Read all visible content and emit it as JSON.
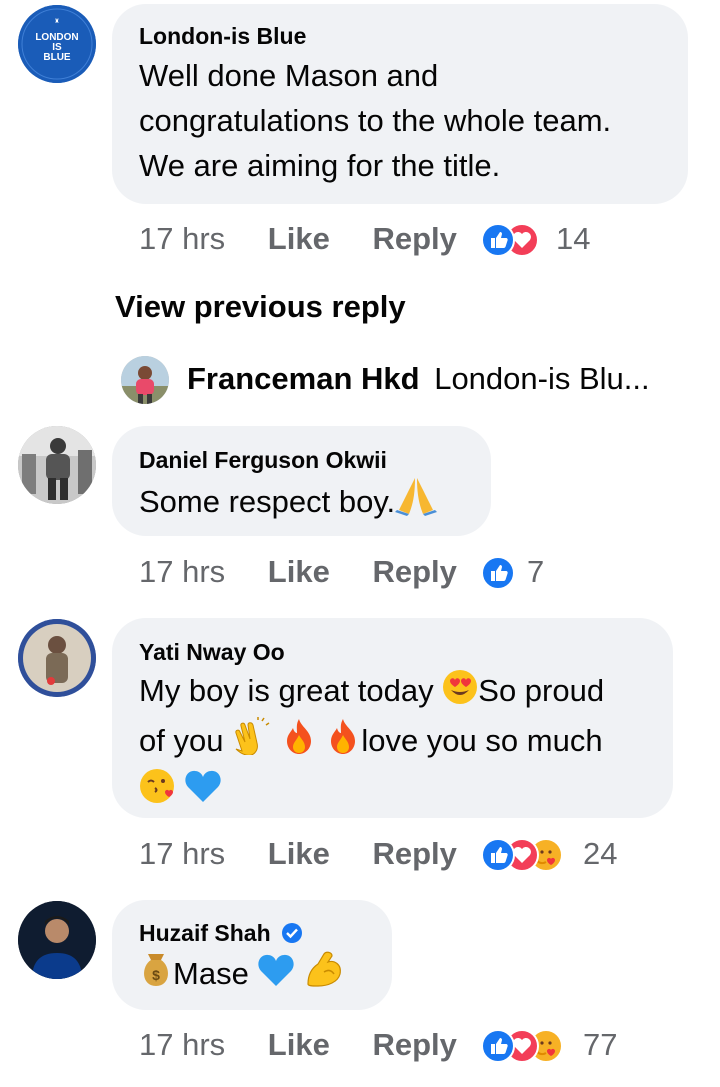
{
  "comments": [
    {
      "author": "London-is Blue",
      "avatar_text": [
        "LONDON",
        "IS",
        "BLUE"
      ],
      "lines": [
        "Well done Mason and",
        "congratulations to the whole team.",
        "We are aiming for the title."
      ],
      "time": "17 hrs",
      "like": "Like",
      "reply": "Reply",
      "reaction_icons": [
        "like-icon",
        "love-icon"
      ],
      "reaction_count": "14"
    },
    {
      "author": "Daniel Ferguson Okwii",
      "lines": [
        "Some respect boy."
      ],
      "time": "17 hrs",
      "like": "Like",
      "reply": "Reply",
      "reaction_icons": [
        "like-icon"
      ],
      "reaction_count": "7"
    },
    {
      "author": "Yati Nway Oo",
      "lines": [
        "My boy is great today",
        "So proud",
        "of you",
        "love you so much"
      ],
      "time": "17 hrs",
      "like": "Like",
      "reply": "Reply",
      "reaction_icons": [
        "like-icon",
        "love-icon",
        "care-icon"
      ],
      "reaction_count": "24"
    },
    {
      "author": "Huzaif Shah",
      "verified": true,
      "lines": [
        "Mase"
      ],
      "time": "17 hrs",
      "like": "Like",
      "reply": "Reply",
      "reaction_icons": [
        "like-icon",
        "love-icon",
        "care-icon"
      ],
      "reaction_count": "77"
    }
  ],
  "view_previous": "View previous reply",
  "reply_preview": {
    "author": "Franceman Hkd",
    "text": "London-is Blu..."
  },
  "colors": {
    "bubble": "#f0f2f5",
    "meta": "#65676b",
    "like_blue": "#1877f2",
    "love_red": "#f33e58",
    "avatar_blue": "#1a5cb8"
  }
}
